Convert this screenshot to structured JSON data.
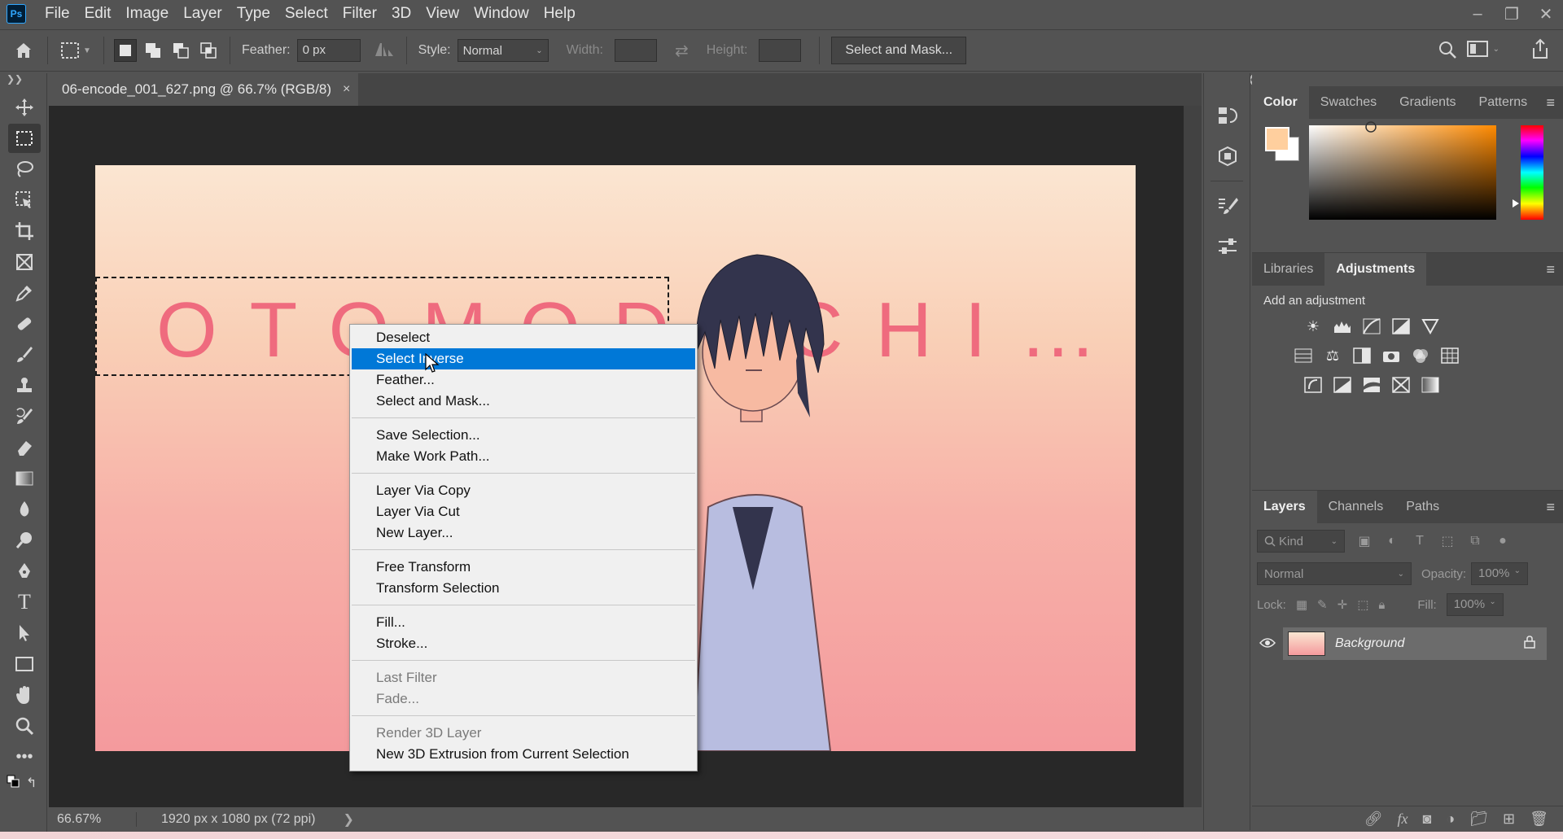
{
  "menubar": {
    "logo": "Ps",
    "items": [
      "File",
      "Edit",
      "Image",
      "Layer",
      "Type",
      "Select",
      "Filter",
      "3D",
      "View",
      "Window",
      "Help"
    ],
    "window_controls": [
      "minimize-icon",
      "restore-icon",
      "close-icon"
    ]
  },
  "options": {
    "feather_label": "Feather:",
    "feather_value": "0 px",
    "style_label": "Style:",
    "style_value": "Normal",
    "width_label": "Width:",
    "height_label": "Height:",
    "select_mask_label": "Select and Mask..."
  },
  "document": {
    "tab_title": "06-encode_001_627.png @ 66.7% (RGB/8)",
    "close_glyph": "×",
    "image_text": "OTOMODACHI…"
  },
  "status": {
    "zoom": "66.67%",
    "doc_info": "1920 px x 1080 px (72 ppi)",
    "arrow": "❯"
  },
  "context_menu": {
    "groups": [
      [
        {
          "label": "Deselect",
          "state": "normal"
        },
        {
          "label": "Select Inverse",
          "state": "highlighted"
        },
        {
          "label": "Feather...",
          "state": "normal"
        },
        {
          "label": "Select and Mask...",
          "state": "normal"
        }
      ],
      [
        {
          "label": "Save Selection...",
          "state": "normal"
        },
        {
          "label": "Make Work Path...",
          "state": "normal"
        }
      ],
      [
        {
          "label": "Layer Via Copy",
          "state": "normal"
        },
        {
          "label": "Layer Via Cut",
          "state": "normal"
        },
        {
          "label": "New Layer...",
          "state": "normal"
        }
      ],
      [
        {
          "label": "Free Transform",
          "state": "normal"
        },
        {
          "label": "Transform Selection",
          "state": "normal"
        }
      ],
      [
        {
          "label": "Fill...",
          "state": "normal"
        },
        {
          "label": "Stroke...",
          "state": "normal"
        }
      ],
      [
        {
          "label": "Last Filter",
          "state": "disabled"
        },
        {
          "label": "Fade...",
          "state": "disabled"
        }
      ],
      [
        {
          "label": "Render 3D Layer",
          "state": "disabled"
        },
        {
          "label": "New 3D Extrusion from Current Selection",
          "state": "normal"
        }
      ]
    ]
  },
  "color_panel": {
    "tabs": [
      "Color",
      "Swatches",
      "Gradients",
      "Patterns"
    ],
    "active_tab": "Color",
    "foreground_color": "#ffcf9e",
    "background_color": "#ffffff"
  },
  "adjustments_panel": {
    "tabs": [
      "Libraries",
      "Adjustments"
    ],
    "active_tab": "Adjustments",
    "title": "Add an adjustment"
  },
  "layers_panel": {
    "tabs": [
      "Layers",
      "Channels",
      "Paths"
    ],
    "active_tab": "Layers",
    "filter_placeholder": "Kind",
    "blend_mode": "Normal",
    "opacity_label": "Opacity:",
    "opacity_value": "100%",
    "lock_label": "Lock:",
    "fill_label": "Fill:",
    "fill_value": "100%",
    "layers": [
      {
        "name": "Background",
        "locked": true,
        "visible": true
      }
    ]
  },
  "theme": {
    "accent": "#0078d7",
    "panel_bg": "#535353",
    "canvas_bg": "#282828",
    "title_text_color": "#ef6b7e"
  }
}
